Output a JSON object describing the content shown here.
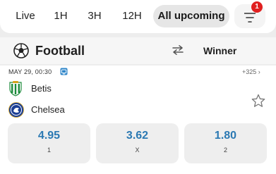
{
  "filters": {
    "chips": [
      "Live",
      "1H",
      "3H",
      "12H",
      "All upcoming"
    ],
    "active": "All upcoming",
    "filter_badge_count": "1"
  },
  "sport": {
    "icon": "football-icon",
    "title": "Football",
    "swap_icon": "swap-arrows-icon",
    "market": "Winner"
  },
  "event": {
    "datetime": "MAY 29, 00:30",
    "tv_icon": "live-stream-icon",
    "more_markets": "+325 ›",
    "home": {
      "name": "Betis",
      "crest": "betis-crest-icon"
    },
    "away": {
      "name": "Chelsea",
      "crest": "chelsea-crest-icon"
    },
    "favorite_icon": "star-icon",
    "odds": [
      {
        "price": "4.95",
        "label": "1"
      },
      {
        "price": "3.62",
        "label": "X"
      },
      {
        "price": "1.80",
        "label": "2"
      }
    ]
  },
  "colors": {
    "odds_text": "#2b79b3",
    "badge": "#e02020",
    "betis_green": "#1a8a3a",
    "chelsea_blue": "#1c3f94"
  }
}
